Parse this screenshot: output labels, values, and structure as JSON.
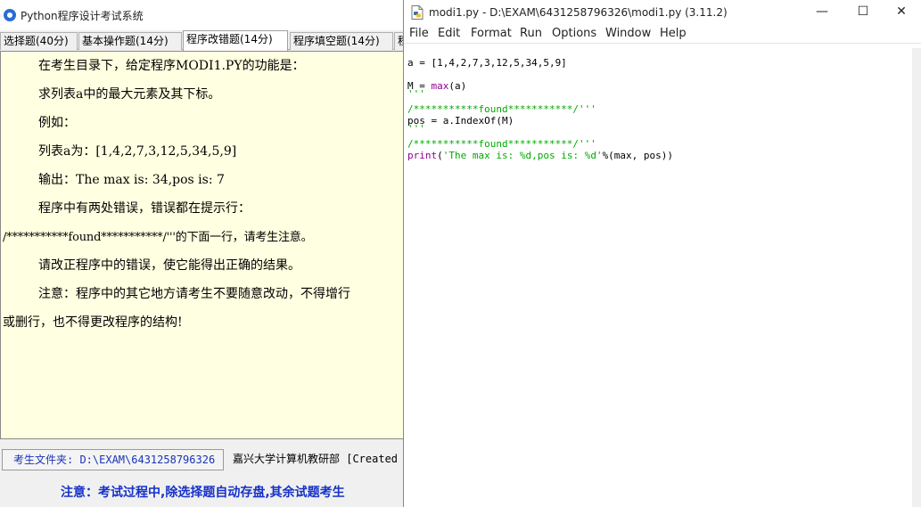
{
  "exam": {
    "title": "Python程序设计考试系统",
    "tabs": [
      {
        "label": "选择题(40分)"
      },
      {
        "label": "基本操作题(14分)"
      },
      {
        "label": "程序改错题(14分)"
      },
      {
        "label": "程序填空题(14分)"
      },
      {
        "label": "程"
      }
    ],
    "question_lines": [
      "在考生目录下，给定程序MODI1.PY的功能是：",
      "求列表a中的最大元素及其下标。",
      "例如：",
      "列表a为：[1,4,2,7,3,12,5,34,5,9]",
      "输出：The max is: 34,pos is: 7",
      "程序中有两处错误，错误都在提示行：",
      "/***********found***********/'''的下面一行，请考生注意。",
      "请改正程序中的错误，使它能得出正确的结果。",
      "注意：程序中的其它地方请考生不要随意改动，不得增行",
      "或删行，也不得更改程序的结构!"
    ],
    "folder_label": "考生文件夹: D:\\EXAM\\6431258796326",
    "credit": "嘉兴大学计算机教研部 [Created",
    "notice": "注意：考试过程中,除选择题自动存盘,其余试题考生"
  },
  "idle": {
    "title": "modi1.py - D:\\EXAM\\6431258796326\\modi1.py (3.11.2)",
    "window_buttons": {
      "minimize": "—",
      "maximize": "☐",
      "close": "✕"
    },
    "menu": [
      "File",
      "Edit",
      "Format",
      "Run",
      "Options",
      "Window",
      "Help"
    ],
    "code": {
      "l1": "a = [1,4,2,7,3,12,5,34,5,9]",
      "l2_pre": "M = ",
      "l2_builtin": "max",
      "l2_post": "(a)",
      "l3": "'''",
      "l4": "/***********found***********/'''",
      "l5": "pos = a.IndexOf(M)",
      "l6": "'''",
      "l7": "/***********found***********/'''",
      "l8_builtin": "print",
      "l8_pre": "(",
      "l8_string": "'The max is: %d,pos is: %d'",
      "l8_post": "%(max, pos))"
    }
  }
}
